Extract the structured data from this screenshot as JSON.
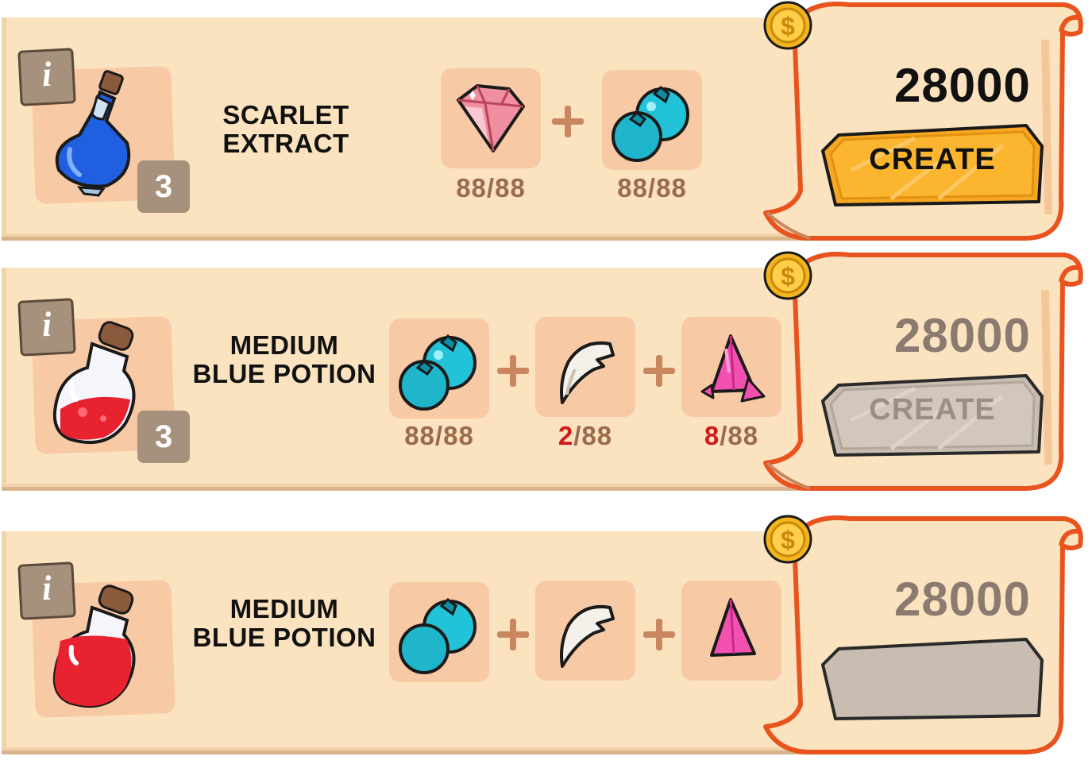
{
  "info_label": "i",
  "create_label": "CREATE",
  "colors": {
    "panel": "#fbe3bf",
    "slot": "#f7c9a5",
    "badge": "#a5917c",
    "quantity": "#9c6b4e",
    "quantity_short": "#d0191a",
    "button_active": "#f7a823",
    "button_disabled": "#c9bdb2",
    "scroll_border": "#e8531e"
  },
  "recipes": [
    {
      "name_line1": "SCARLET",
      "name_line2": "EXTRACT",
      "product_icon": "blue-potion-flask-icon",
      "count": "3",
      "price": "28000",
      "create_enabled": true,
      "ingredients": [
        {
          "icon": "pink-gem-icon",
          "have": "88",
          "need": "/88"
        },
        {
          "icon": "blueberry-icon",
          "have": "88",
          "need": "/88"
        }
      ]
    },
    {
      "name_line1": "MEDIUM",
      "name_line2": "BLUE POTION",
      "product_icon": "red-potion-jar-icon",
      "count": "3",
      "price": "28000",
      "create_enabled": false,
      "ingredients": [
        {
          "icon": "blueberry-icon",
          "have": "88",
          "need": "/88"
        },
        {
          "icon": "fang-icon",
          "have": "2",
          "need": "/88"
        },
        {
          "icon": "pink-crystal-icon",
          "have": "8",
          "need": "/88"
        }
      ]
    },
    {
      "name_line1": "MEDIUM",
      "name_line2": "BLUE POTION",
      "product_icon": "red-potion-jar-icon",
      "price": "28000",
      "create_enabled": false,
      "ingredients": [
        {
          "icon": "blueberry-icon"
        },
        {
          "icon": "fang-icon"
        },
        {
          "icon": "pink-crystal-icon"
        }
      ]
    }
  ]
}
